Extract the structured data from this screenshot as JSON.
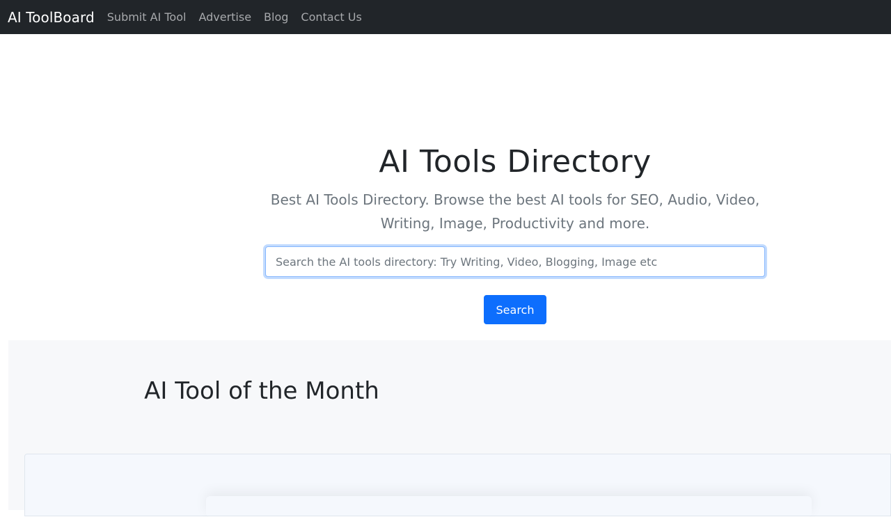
{
  "navbar": {
    "brand": "AI ToolBoard",
    "links": [
      "Submit AI Tool",
      "Advertise",
      "Blog",
      "Contact Us"
    ]
  },
  "hero": {
    "title": "AI Tools Directory",
    "lead": "Best AI Tools Directory. Browse the best AI tools for SEO, Audio, Video, Writing, Image, Productivity and more.",
    "search": {
      "placeholder": "Search the AI tools directory: Try Writing, Video, Blogging, Image etc",
      "value": ""
    },
    "search_button_label": "Search"
  },
  "featured": {
    "title": "AI Tool of the Month"
  },
  "colors": {
    "navbar_bg": "#212529",
    "primary": "#0d6efd",
    "section_bg": "#f7f8fa"
  }
}
